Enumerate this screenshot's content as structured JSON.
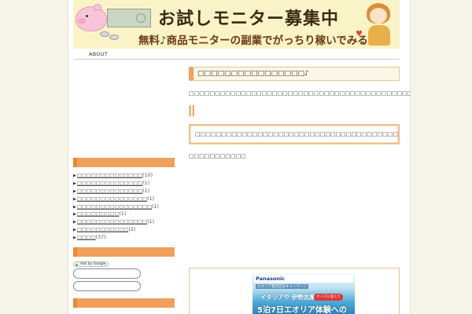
{
  "header": {
    "title": "お試しモニター募集中",
    "subtitle": "無料♪商品モニターの副業でがっちり稼いでみる"
  },
  "nav": {
    "items": [
      "ABOUT"
    ]
  },
  "sidebar": {
    "categories": [
      {
        "name": "□□□□□□□□□□□□□□",
        "count": "(10)"
      },
      {
        "name": "□□□□□□□□□□□□□□",
        "count": "(1)"
      },
      {
        "name": "□□□□□□□□□□□□□□",
        "count": "(1)"
      },
      {
        "name": "□□□□□□□□□□□□□□□",
        "count": "(1)"
      },
      {
        "name": "□□□□□□□□□□□□□□□□",
        "count": "(1)"
      },
      {
        "name": "□□□□□□□□□",
        "count": "(1)"
      },
      {
        "name": "□□□□□□□□□□□□□□□",
        "count": "(1)"
      },
      {
        "name": "□□□□□□□□□□□",
        "count": "(2)"
      },
      {
        "name": "□□□□",
        "count": "(37)"
      }
    ],
    "ads_label": "Ads by Google"
  },
  "main": {
    "post_title": "□□□□□□□□□□□□□□□□♪",
    "post_text": "□□□□□□□□□□□□□□□□□□□□□□□□□□□□□□□□□□□□□□□□□□□□□□□□□□□□□□□□□□",
    "pipes": "||",
    "quote_text": "□□□□□□□□□□□□□□□□□□□□□□□□□□□□□□□□□□□□□□□□□□□□□□□□□□□□□□□□□",
    "small_text": "□□□□□□□□□□□"
  },
  "ad": {
    "brand": "Panasonic",
    "sub": "エオリア発売記念キャンペーン",
    "line1": "イタリアや 伊勢志摩",
    "chip": "クイズに答えて",
    "line2": "5泊7日エオリア体験への"
  },
  "colors": {
    "accent": "#f0a05c",
    "accent_dark": "#e98a36",
    "banner_bg": "#fbf3c8",
    "page_bg": "#f7f4ea"
  }
}
